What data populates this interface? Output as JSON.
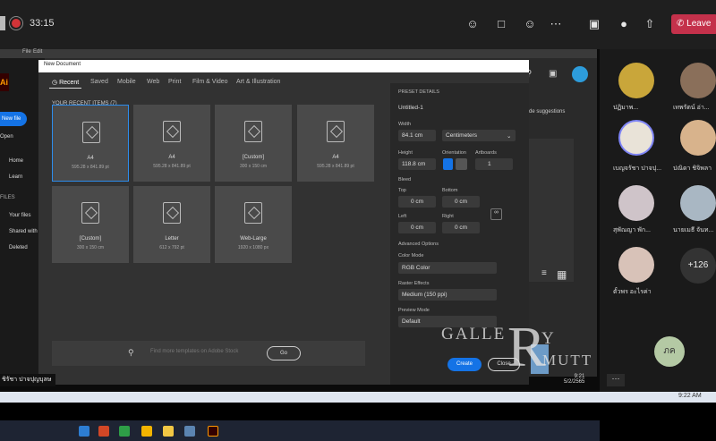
{
  "meeting": {
    "timer": "33:15",
    "leave_label": "Leave"
  },
  "ai": {
    "menubar": [
      "File",
      "Edit"
    ],
    "logo": "Ai",
    "new_file": "New file",
    "open": "Open",
    "nav": [
      "Home",
      "Learn"
    ],
    "files_header": "FILES",
    "file_nav": [
      "Your files",
      "Shared with",
      "Deleted"
    ],
    "suggestions": "de suggestions"
  },
  "dialog": {
    "title": "New Document",
    "tabs": [
      "Recent",
      "Saved",
      "Mobile",
      "Web",
      "Print",
      "Film & Video",
      "Art & Illustration"
    ],
    "recent_header": "YOUR RECENT ITEMS  (7)",
    "items": [
      {
        "name": "A4",
        "size": "595.28 x 841.89 pt"
      },
      {
        "name": "A4",
        "size": "595.28 x 841.89 pt"
      },
      {
        "name": "[Custom]",
        "size": "300 x 150 cm"
      },
      {
        "name": "A4",
        "size": "595.28 x 841.89 pt"
      },
      {
        "name": "[Custom]",
        "size": "300 x 150 cm"
      },
      {
        "name": "Letter",
        "size": "612 x 792 pt"
      },
      {
        "name": "Web-Large",
        "size": "1920 x 1080 px"
      }
    ],
    "search_placeholder": "Find more templates on Adobe Stock",
    "go_label": "Go",
    "preset": {
      "header": "PRESET DETAILS",
      "name": "Untitled-1",
      "width_label": "Width",
      "width_value": "84.1 cm",
      "units": "Centimeters",
      "height_label": "Height",
      "height_value": "118.8 cm",
      "orientation_label": "Orientation",
      "artboards_label": "Artboards",
      "artboards_value": "1",
      "bleed_label": "Bleed",
      "top_label": "Top",
      "top_value": "0 cm",
      "bottom_label": "Bottom",
      "bottom_value": "0 cm",
      "left_label": "Left",
      "left_value": "0 cm",
      "right_label": "Right",
      "right_value": "0 cm",
      "advanced": "Advanced Options",
      "color_mode_label": "Color Mode",
      "color_mode_value": "RGB Color",
      "raster_label": "Raster Effects",
      "raster_value": "Medium (150 ppi)",
      "preview_label": "Preview Mode",
      "preview_value": "Default"
    },
    "create_label": "Create",
    "close_label": "Close"
  },
  "watermark": {
    "line1": "GALLE",
    "big": "R",
    "y": "Y",
    "mutt": "MUTT"
  },
  "taskbar": {
    "time": "9:21",
    "date": "5/2/2565"
  },
  "participants": [
    {
      "name": "ปฏิมาพ..."
    },
    {
      "name": "เทพรัตน์ อ่า..."
    },
    {
      "name": "เบญจรัชา ปาจปุ..."
    },
    {
      "name": "ปณิดา ชิจิพลา"
    },
    {
      "name": "สุพัณญา พัก..."
    },
    {
      "name": "นายเมธี จันท..."
    },
    {
      "name": "ตั้วพร อะไรค่า"
    }
  ],
  "more_count": "+126",
  "self_avatar": "ภค",
  "caption": "ชิรัชา ปาจปุญบุลษ",
  "bottom_time": "9:22 AM",
  "colors": {
    "accent": "#1473e6",
    "leave": "#c4314b",
    "selected": "#2d8ceb"
  }
}
